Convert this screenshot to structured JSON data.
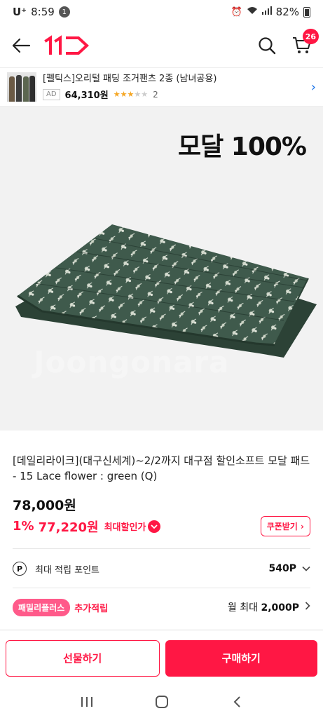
{
  "status_bar": {
    "carrier": "U⁺",
    "time": "8:59",
    "notification_count": "1",
    "battery": "82%"
  },
  "app_bar": {
    "logo_icon": "11st-logo",
    "cart_count": "26"
  },
  "ad": {
    "title": "[펠틱스]오리털 패딩 조거팬츠 2종 (남녀공용)",
    "badge": "AD",
    "price": "64,310원",
    "rating": 3,
    "rating_max": 5,
    "review_count": "2"
  },
  "product_image": {
    "banner": "모달 100%",
    "watermark": "Joongonara"
  },
  "product": {
    "title": "[데일리라이크](대구신세계)~2/2까지 대구점 할인소프트 모달 패드 - 15 Lace flower : green (Q)",
    "original_price": "78,000원",
    "discount_rate": "1%",
    "sale_price": "77,220원",
    "max_discount_label": "최대할인가",
    "coupon_label": "쿠폰받기"
  },
  "points": {
    "icon_letter": "P",
    "label": "최대 적립 포인트",
    "value": "540P"
  },
  "family": {
    "badge": "패밀리플러스",
    "extra_label": "추가적립",
    "value_prefix": "월 최대",
    "value": "2,000P"
  },
  "actions": {
    "gift": "선물하기",
    "buy": "구매하기"
  },
  "colors": {
    "accent": "#ff1744",
    "family_badge": "#ff5a8a",
    "mat_green": "#3f5a4c",
    "star": "#f5a623"
  }
}
